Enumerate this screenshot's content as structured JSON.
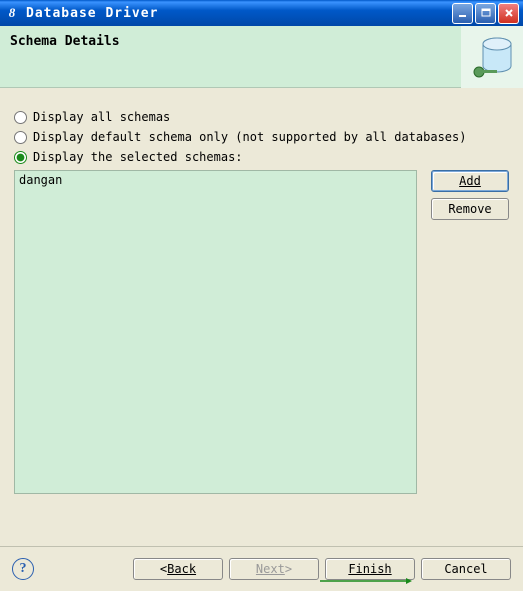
{
  "window": {
    "title": "Database Driver"
  },
  "header": {
    "heading": "Schema Details"
  },
  "options": {
    "all": "Display all schemas",
    "default": "Display default schema only (not supported by all databases)",
    "selected": "Display the selected schemas:"
  },
  "schema_list": {
    "items": [
      "dangan"
    ]
  },
  "buttons": {
    "add": "Add",
    "remove": "Remove",
    "back_prefix": "< ",
    "back": "Back",
    "next": "Next",
    "next_suffix": " >",
    "finish": "Finish",
    "cancel": "Cancel"
  }
}
